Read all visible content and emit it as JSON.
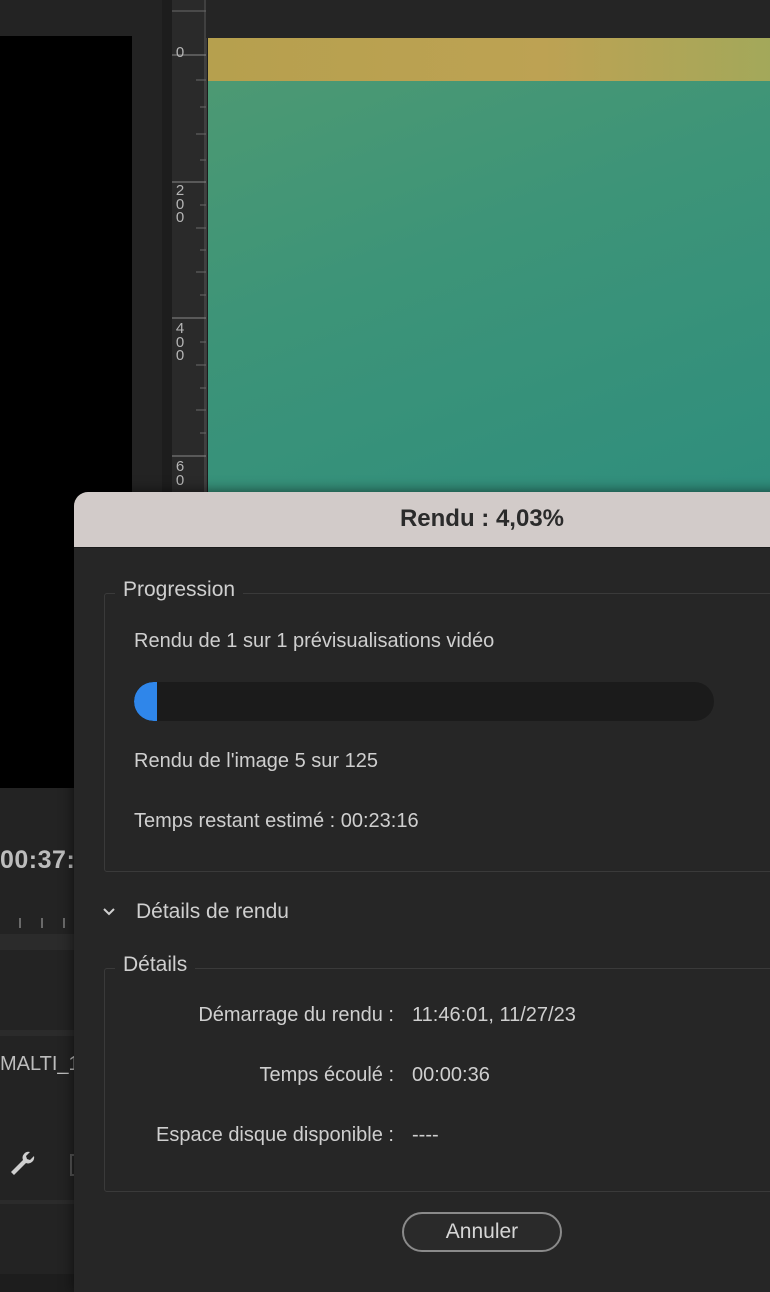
{
  "background": {
    "timecode": "00:37:",
    "clip_name": "MALTI_1",
    "ruler_labels": [
      "0",
      "200",
      "400",
      "60"
    ],
    "icons": [
      "wrench-icon"
    ]
  },
  "dialog": {
    "title": "Rendu : 4,03%",
    "progress_group": {
      "legend": "Progression",
      "status": "Rendu de 1 sur 1 prévisualisations vidéo",
      "progress_percent": 4.03,
      "frame_text": "Rendu de l'image 5 sur 125",
      "time_remaining": "Temps restant estimé : 00:23:16"
    },
    "details_toggle": {
      "label": "Détails de rendu",
      "icon": "chevron-down-icon",
      "expanded": true
    },
    "details_group": {
      "legend": "Détails",
      "rows": [
        {
          "label": "Démarrage du rendu :",
          "value": "11:46:01, 11/27/23"
        },
        {
          "label": "Temps écoulé :",
          "value": "00:00:36"
        },
        {
          "label": "Espace disque disponible :",
          "value": "----"
        }
      ]
    },
    "cancel_label": "Annuler"
  },
  "colors": {
    "progress_fill": "#2f86ea",
    "title_bar": "#d2cbc9",
    "dialog_bg": "#262626"
  }
}
